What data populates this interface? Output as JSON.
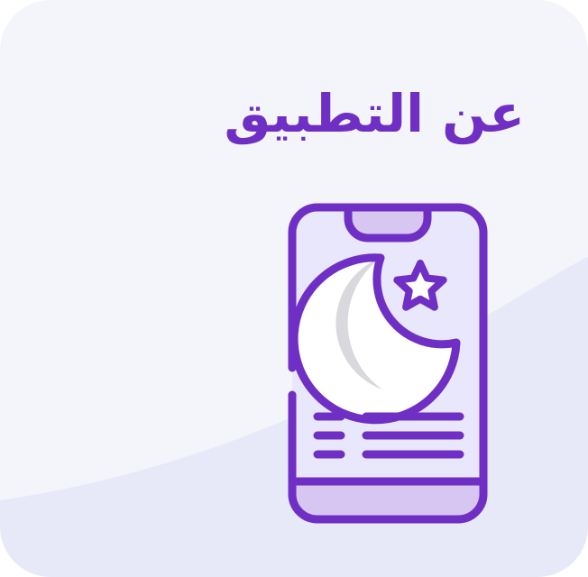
{
  "card": {
    "title": "عن التطبيق",
    "icon": "phone-crescent-star-icon"
  },
  "colors": {
    "accent": "#6f2fc4",
    "card_background": "#f4f4fb",
    "wave": "#e8e9f8",
    "phone_screen": "#e9e7fb",
    "phone_notch": "#d7c5f2",
    "crescent_fill": "#ffffff",
    "crescent_shadow": "#d9d9dd"
  }
}
